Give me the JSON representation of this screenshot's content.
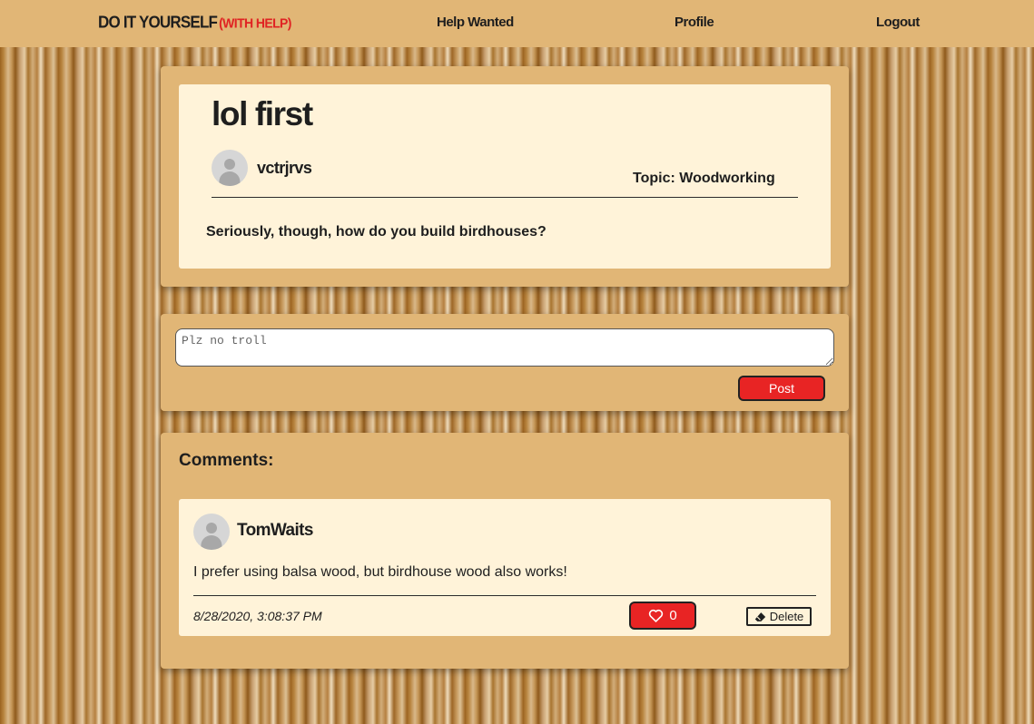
{
  "nav": {
    "brand": "DO IT YOURSELF",
    "brand_sub": "(WITH HELP)",
    "links": [
      "Help Wanted",
      "Profile",
      "Logout"
    ]
  },
  "post": {
    "title": "lol first",
    "author": "vctrjrvs",
    "topic": "Topic: Woodworking",
    "body": "Seriously, though, how do you build birdhouses?"
  },
  "comment_form": {
    "placeholder": "Plz no troll",
    "submit_label": "Post"
  },
  "comments": {
    "heading": "Comments:",
    "items": [
      {
        "author": "TomWaits",
        "text": "I prefer using balsa wood, but birdhouse wood also works!",
        "timestamp": "8/28/2020, 3:08:37 PM",
        "likes": "0",
        "delete_label": "Delete"
      }
    ]
  },
  "colors": {
    "nav_bg": "#e1b676",
    "card_bg": "#e1b676",
    "inner_bg": "#fff3d9",
    "accent_red": "#e82424",
    "brand_red": "#e02323"
  },
  "icons": [
    "default-avatar-icon",
    "heart-icon",
    "eraser-icon"
  ]
}
